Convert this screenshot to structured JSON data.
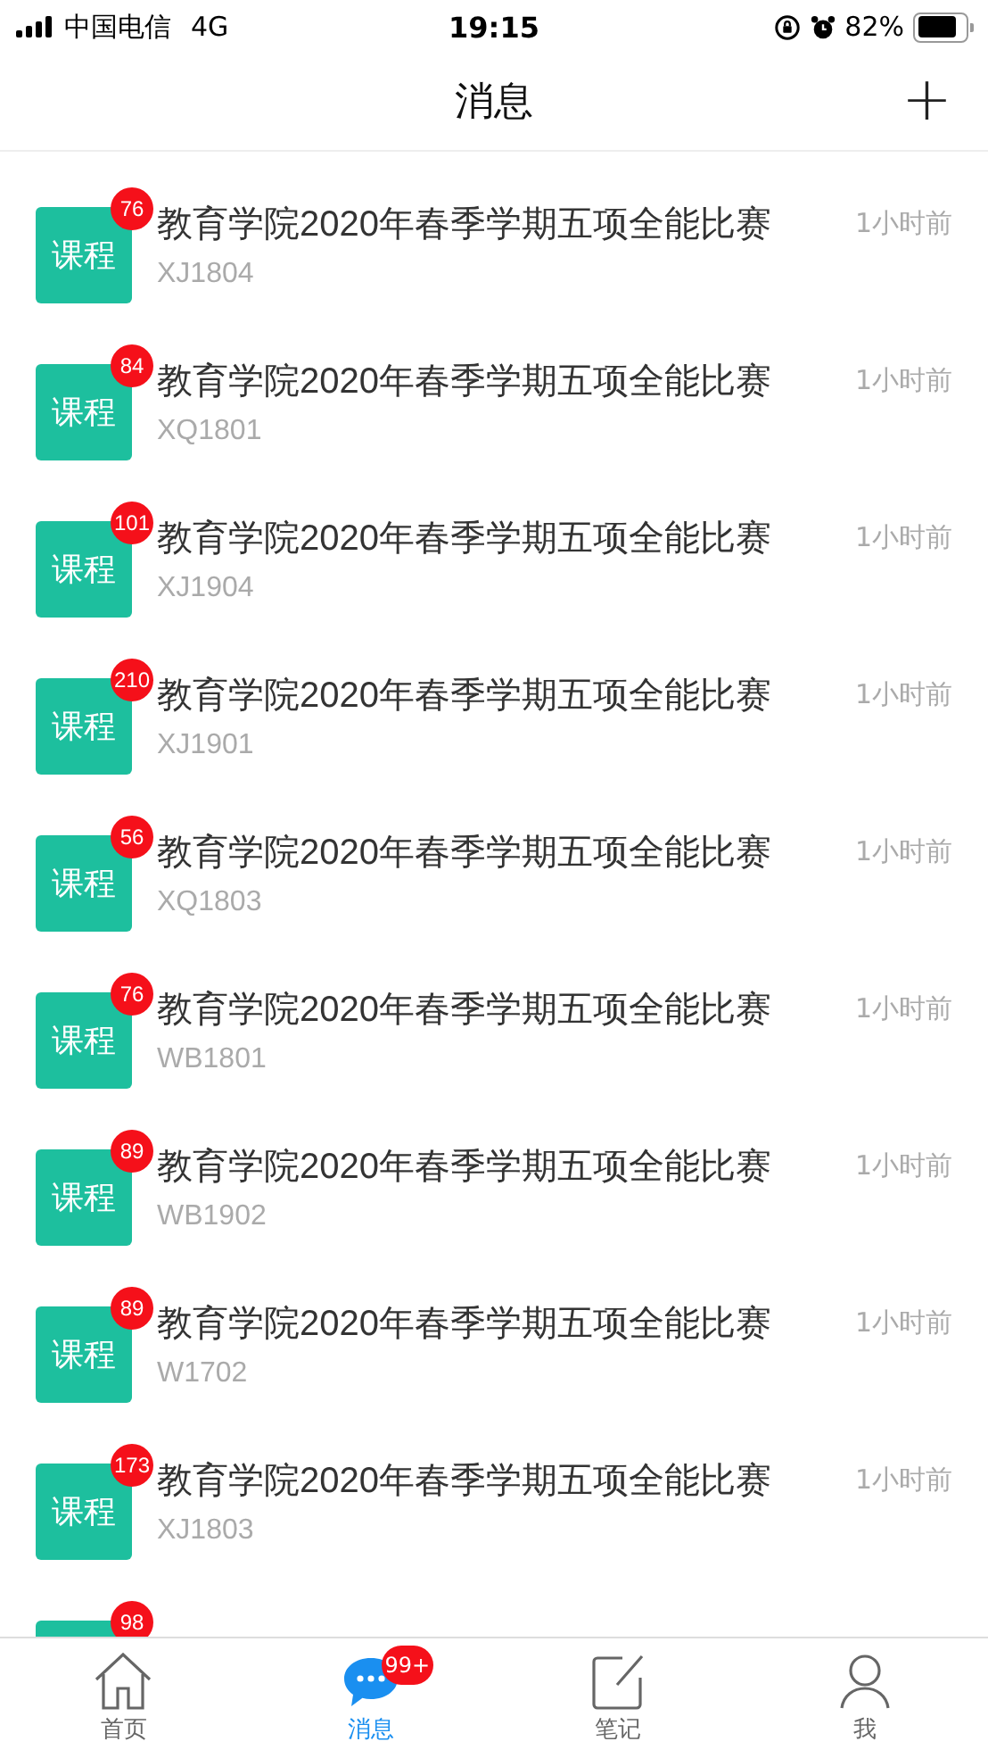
{
  "status_bar": {
    "carrier": "中国电信",
    "network": "4G",
    "time": "19:15",
    "battery": "82%"
  },
  "header": {
    "title": "消息",
    "action": "+"
  },
  "messages": [
    {
      "tag": "课程",
      "badge": "76",
      "title": "教育学院2020年春季学期五项全能比赛",
      "time": "1小时前",
      "code": "XJ1804"
    },
    {
      "tag": "课程",
      "badge": "84",
      "title": "教育学院2020年春季学期五项全能比赛",
      "time": "1小时前",
      "code": "XQ1801"
    },
    {
      "tag": "课程",
      "badge": "101",
      "title": "教育学院2020年春季学期五项全能比赛",
      "time": "1小时前",
      "code": "XJ1904"
    },
    {
      "tag": "课程",
      "badge": "210",
      "title": "教育学院2020年春季学期五项全能比赛",
      "time": "1小时前",
      "code": "XJ1901"
    },
    {
      "tag": "课程",
      "badge": "56",
      "title": "教育学院2020年春季学期五项全能比赛",
      "time": "1小时前",
      "code": "XQ1803"
    },
    {
      "tag": "课程",
      "badge": "76",
      "title": "教育学院2020年春季学期五项全能比赛",
      "time": "1小时前",
      "code": "WB1801"
    },
    {
      "tag": "课程",
      "badge": "89",
      "title": "教育学院2020年春季学期五项全能比赛",
      "time": "1小时前",
      "code": "WB1902"
    },
    {
      "tag": "课程",
      "badge": "89",
      "title": "教育学院2020年春季学期五项全能比赛",
      "time": "1小时前",
      "code": "W1702"
    },
    {
      "tag": "课程",
      "badge": "173",
      "title": "教育学院2020年春季学期五项全能比赛",
      "time": "1小时前",
      "code": "XJ1803"
    },
    {
      "badge": "98"
    }
  ],
  "tab_bar": [
    {
      "kind": "home",
      "label": "首页",
      "selected": false
    },
    {
      "kind": "chat",
      "label": "消息",
      "selected": true,
      "badge": "99+"
    },
    {
      "kind": "note",
      "label": "笔记",
      "selected": false
    },
    {
      "kind": "user",
      "label": "我",
      "selected": false
    }
  ]
}
